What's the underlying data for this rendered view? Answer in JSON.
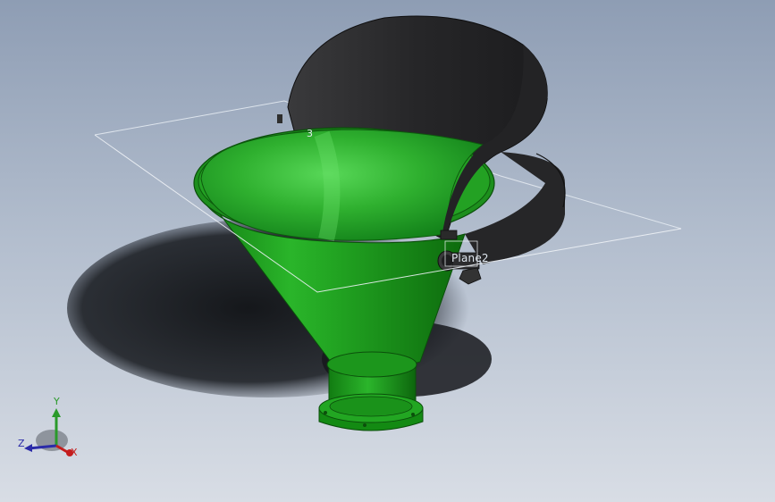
{
  "viewport": {
    "plane_label": "Plane2",
    "sketch_label": "3"
  },
  "triad": {
    "x_label": "X",
    "y_label": "Y",
    "z_label": "Z"
  },
  "colors": {
    "background_top": "#8e9db4",
    "background_bottom": "#d8dde5",
    "hopper_green": "#1f9a1f",
    "hopper_highlight": "#4fd04f",
    "cover_dark": "#2b2b2d",
    "shadow": "#121417",
    "x_axis": "#c41d1d",
    "y_axis": "#2a9a2a",
    "z_axis": "#2b2ba8"
  },
  "icons": [
    "coordinate-triad-icon",
    "hopper-model",
    "reference-plane",
    "hinge-bolt-icon"
  ]
}
